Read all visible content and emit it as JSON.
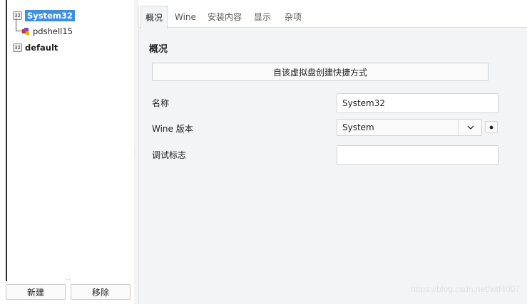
{
  "tree": {
    "items": [
      {
        "label": "System32",
        "badge": "32",
        "selected": true
      },
      {
        "label": "pdshell15",
        "child": true
      },
      {
        "label": "default",
        "badge": "32"
      }
    ]
  },
  "buttons": {
    "new_label": "新建",
    "remove_label": "移除"
  },
  "tabs": [
    {
      "label": "概况",
      "active": true
    },
    {
      "label": "Wine"
    },
    {
      "label": "安装内容"
    },
    {
      "label": "显示"
    },
    {
      "label": "杂项"
    }
  ],
  "overview": {
    "title": "概况",
    "shortcut_button": "自该虚拟盘创建快捷方式",
    "name_label": "名称",
    "name_value": "System32",
    "wine_version_label": "Wine 版本",
    "wine_version_value": "System",
    "debug_flags_label": "调试标志",
    "debug_flags_value": ""
  },
  "watermark": "https://blog.csdn.net/wtf4007",
  "icons": {
    "badge": "disk-32-icon",
    "app": "app-icon",
    "dropdown": "chevron-down-icon",
    "extra": "dot-button-icon"
  },
  "colors": {
    "selection": "#3d8fe0",
    "panel_bg": "#f3f4f5"
  }
}
